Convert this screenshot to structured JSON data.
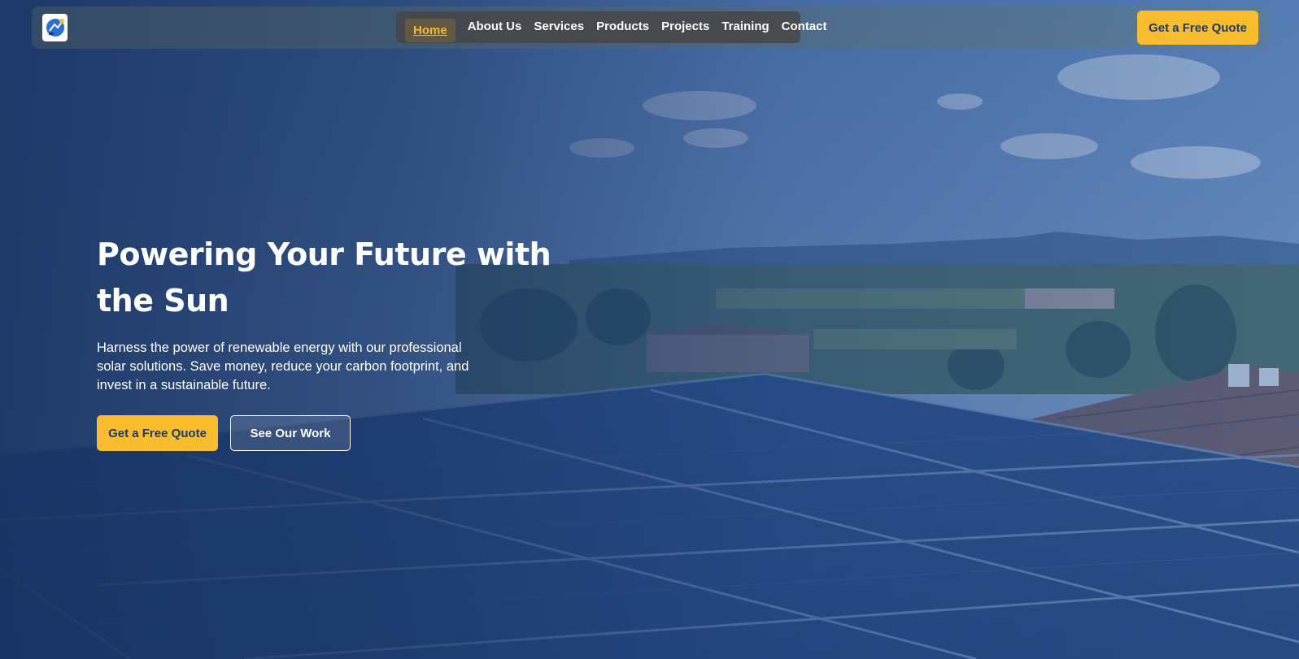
{
  "nav": {
    "logo_icon": "solar-logo-icon",
    "items": [
      {
        "label": "Home",
        "active": true
      },
      {
        "label": "About Us"
      },
      {
        "label": "Services"
      },
      {
        "label": "Products"
      },
      {
        "label": "Projects"
      },
      {
        "label": "Training"
      },
      {
        "label": "Contact"
      }
    ],
    "cta_label": "Get a Free Quote"
  },
  "hero": {
    "title": "Powering Your Future with the Sun",
    "subtitle": "Harness the power of renewable energy with our professional solar solutions. Save money, reduce your carbon footprint, and invest in a sustainable future.",
    "primary_button": "Get a Free Quote",
    "secondary_button": "See Our Work",
    "background_image": "solar-panels-on-roof"
  },
  "colors": {
    "accent": "#f7bd2e",
    "brand_blue": "#1e3a6e",
    "overlay": "#1c3a6c"
  }
}
